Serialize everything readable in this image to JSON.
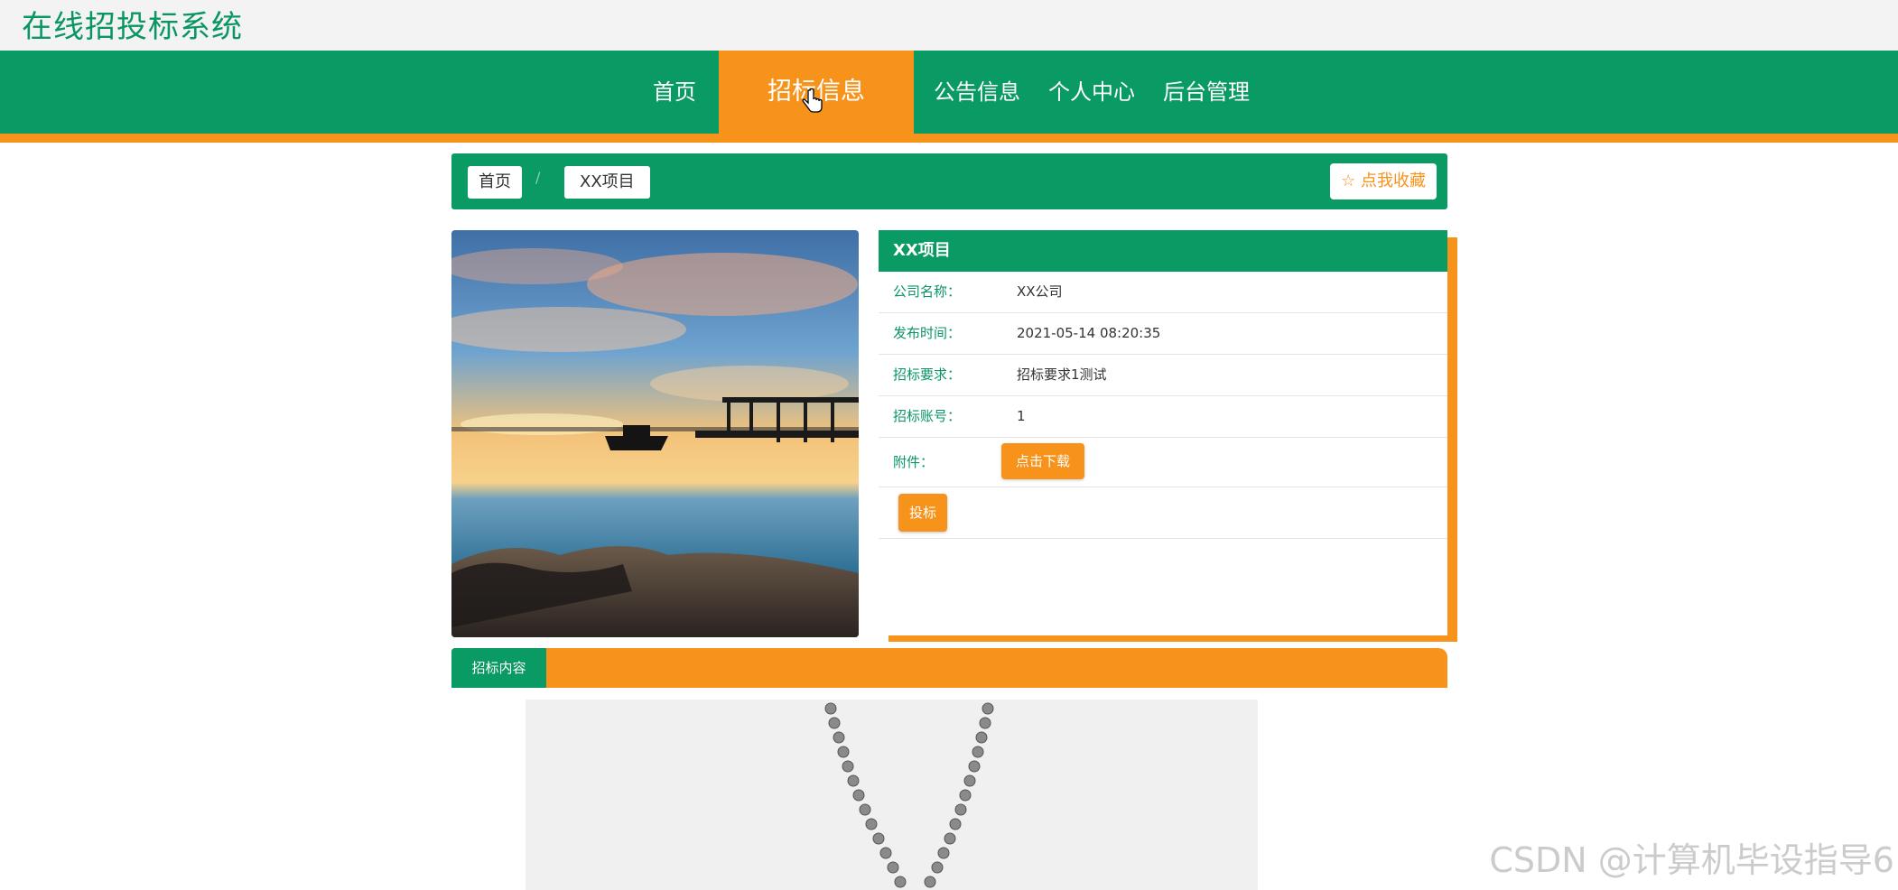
{
  "site": {
    "title": "在线招投标系统"
  },
  "nav": {
    "items": [
      {
        "label": "首页"
      },
      {
        "label": "招标信息"
      },
      {
        "label": "公告信息"
      },
      {
        "label": "个人中心"
      },
      {
        "label": "后台管理"
      }
    ],
    "active_index": 1
  },
  "breadcrumb": {
    "home": "首页",
    "separator": "/",
    "current": "XX项目",
    "favorite_label": "☆ 点我收藏"
  },
  "detail": {
    "title": "XX项目",
    "fields": [
      {
        "label": "公司名称：",
        "value": "XX公司"
      },
      {
        "label": "发布时间：",
        "value": "2021-05-14 08:20:35"
      },
      {
        "label": "招标要求：",
        "value": "招标要求1测试"
      },
      {
        "label": "招标账号：",
        "value": "1"
      }
    ],
    "attachment_label": "附件：",
    "download_label": "点击下载",
    "bid_label": "投标"
  },
  "content": {
    "tab_label": "招标内容"
  },
  "watermark": "CSDN @计算机毕设指导6",
  "colors": {
    "primary": "#0a9a63",
    "accent": "#f7931a"
  }
}
